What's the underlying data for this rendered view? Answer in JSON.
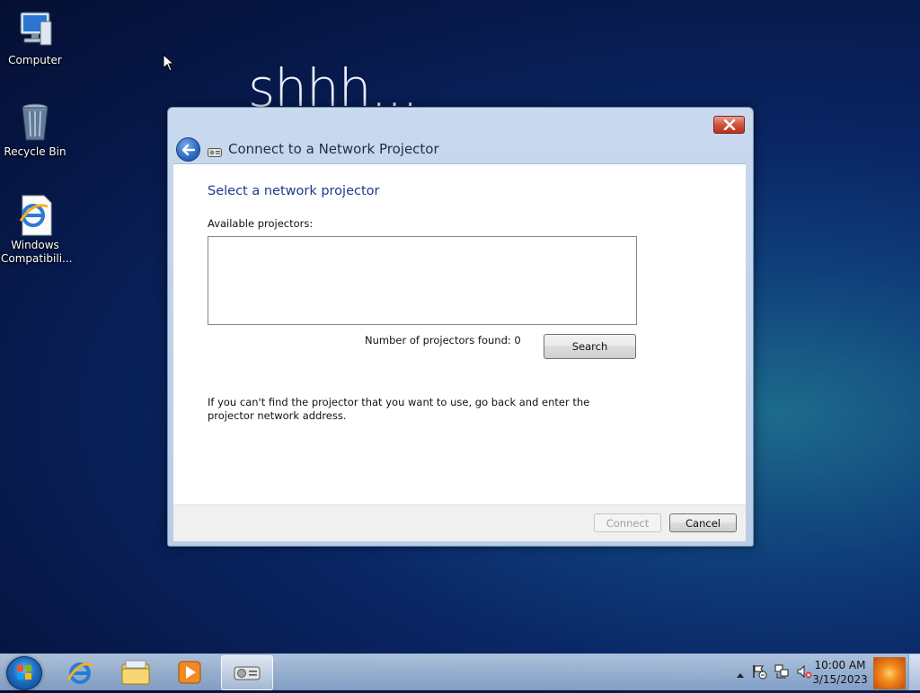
{
  "desktop": {
    "wallpaper_text": "shhh...",
    "icons": [
      {
        "label": "Computer",
        "icon": "computer-icon"
      },
      {
        "label": "Recycle Bin",
        "icon": "recycle-bin-icon"
      },
      {
        "label": "Windows Compatibili...",
        "icon": "ie-shortcut-icon"
      }
    ]
  },
  "dialog": {
    "title": "Connect to a Network Projector",
    "heading": "Select a network projector",
    "available_label": "Available projectors:",
    "projectors": [],
    "found_text": "Number of projectors found: 0",
    "search_label": "Search",
    "help_text": "If you can't find the projector that you want to use, go back and enter the projector network address.",
    "connect_label": "Connect",
    "cancel_label": "Cancel"
  },
  "taskbar": {
    "pinned": [
      "internet-explorer-icon",
      "explorer-folder-icon",
      "media-player-icon",
      "network-projector-icon"
    ],
    "clock_time": "10:00 AM",
    "clock_date": "3/15/2023"
  },
  "colors": {
    "heading_blue": "#1e3a8a",
    "close_red": "#c8452f"
  }
}
